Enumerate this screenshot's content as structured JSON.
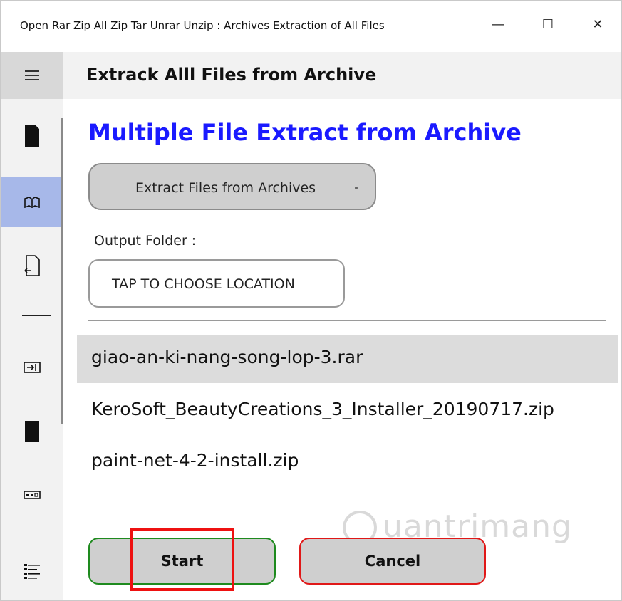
{
  "window": {
    "title": "Open Rar Zip All Zip Tar Unrar Unzip : Archives Extraction of All Files",
    "minimize": "—",
    "maximize": "☐",
    "close": "✕"
  },
  "sidebar": {
    "items": [
      {
        "icon": "menu-icon"
      },
      {
        "icon": "file-icon"
      },
      {
        "icon": "open-book-icon",
        "active": true
      },
      {
        "icon": "page-export-icon"
      },
      {
        "icon": "divider"
      },
      {
        "icon": "import-arrow-icon"
      },
      {
        "icon": "sd-card-icon"
      },
      {
        "icon": "input-box-icon"
      },
      {
        "icon": "list-icon"
      }
    ],
    "active_color": "#a7b8e9"
  },
  "header": {
    "title": "Extrack Alll Files from  Archive"
  },
  "main": {
    "heading": "Multiple File Extract from Archive",
    "heading_color": "#1a1aff",
    "mode_dropdown": {
      "selected": "Extract Files from Archives"
    },
    "output_folder_label": "Output Folder :",
    "choose_location_button": "TAP TO CHOOSE LOCATION",
    "files": [
      {
        "name": "giao-an-ki-nang-song-lop-3.rar",
        "selected": true
      },
      {
        "name": "KeroSoft_BeautyCreations_3_Installer_20190717.zip",
        "selected": false
      },
      {
        "name": "paint-net-4-2-install.zip",
        "selected": false
      }
    ],
    "start_button": "Start",
    "cancel_button": "Cancel"
  },
  "watermark": "uantrimang",
  "colors": {
    "start_border": "#1e8a1e",
    "cancel_border": "#e01818",
    "highlight_box": "#ee1111"
  }
}
